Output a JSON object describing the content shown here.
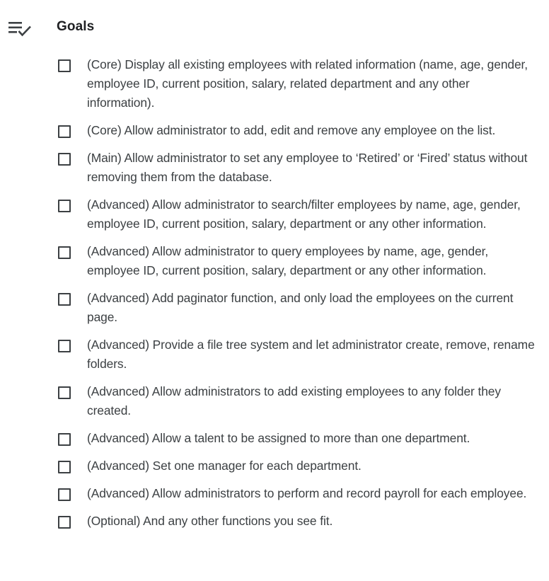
{
  "header": {
    "icon": "checklist-icon",
    "title": "Goals"
  },
  "goals": [
    {
      "checked": false,
      "text": "(Core) Display all existing employees with related information (name, age, gender, employee ID, current position, salary, related department and any other information)."
    },
    {
      "checked": false,
      "text": "(Core) Allow administrator to add, edit and remove any employee on the list."
    },
    {
      "checked": false,
      "text": "(Main) Allow administrator to set any employee to ‘Retired’ or ‘Fired’ status without removing them from the database."
    },
    {
      "checked": false,
      "text": "(Advanced) Allow administrator to search/filter employees by name, age, gender, employee ID, current position, salary, department or any other information."
    },
    {
      "checked": false,
      "text": "(Advanced) Allow administrator to query employees by name, age, gender, employee ID, current position, salary, department or any other information."
    },
    {
      "checked": false,
      "text": "(Advanced) Add paginator function, and only load the employees on the current page."
    },
    {
      "checked": false,
      "text": "(Advanced) Provide a file tree system and let administrator create, remove, rename folders."
    },
    {
      "checked": false,
      "text": "(Advanced) Allow administrators to add existing employees to any folder they created."
    },
    {
      "checked": false,
      "text": "(Advanced) Allow a talent to be assigned to more than one department."
    },
    {
      "checked": false,
      "text": "(Advanced) Set one manager for each department."
    },
    {
      "checked": false,
      "text": "(Advanced) Allow administrators to perform and record payroll for each employee."
    },
    {
      "checked": false,
      "text": "(Optional) And any other functions you see fit."
    }
  ]
}
